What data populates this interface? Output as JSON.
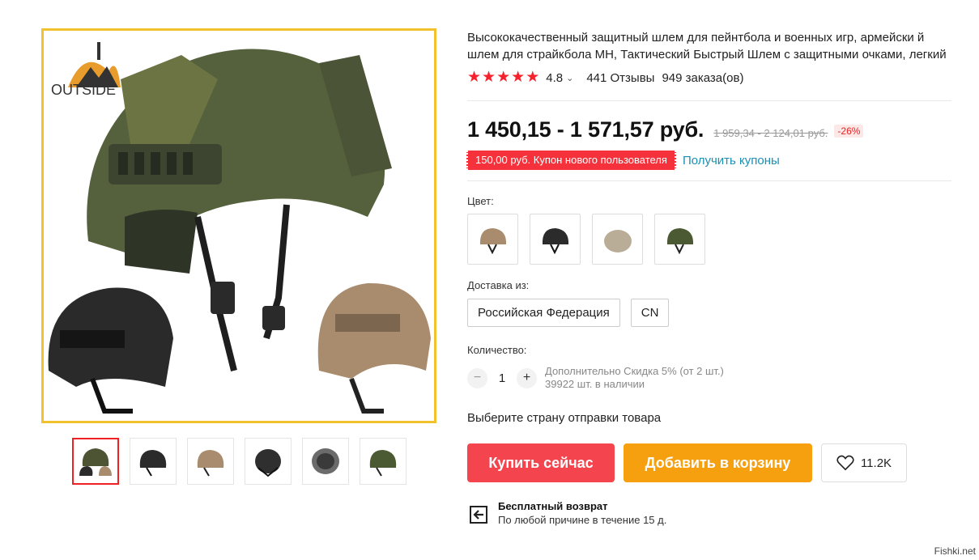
{
  "gallery": {
    "brand_logo_text": "OUTSIDE",
    "thumbnails": [
      {
        "icon": "helmet-set-thumb",
        "active": true,
        "color": "#4d5433"
      },
      {
        "icon": "helmet-black-thumb",
        "active": false,
        "color": "#2b2b2b"
      },
      {
        "icon": "helmet-tan-thumb",
        "active": false,
        "color": "#a88c6d"
      },
      {
        "icon": "helmet-black-back-thumb",
        "active": false,
        "color": "#2f2f2f"
      },
      {
        "icon": "helmet-inside-thumb",
        "active": false,
        "color": "#555"
      },
      {
        "icon": "helmet-green-thumb",
        "active": false,
        "color": "#4b5a33"
      }
    ]
  },
  "product": {
    "title": "Высококачественный защитный шлем для пейнтбола и военных игр, армейски й шлем для страйкбола MH, Тактический Быстрый Шлем с защитными очками, легкий",
    "rating": "4.8",
    "reviews": "441 Отзывы",
    "orders": "949 заказа(ов)",
    "price": "1 450,15 - 1 571,57 руб.",
    "old_price": "1 959,34 - 2 124,01 руб.",
    "discount": "-26%",
    "coupon_text": "150,00 руб. Купон нового пользователя",
    "get_coupons": "Получить купоны",
    "color_label": "Цвет:",
    "colors": [
      {
        "name": "tan",
        "color": "#a88c6d"
      },
      {
        "name": "black",
        "color": "#2b2b2b"
      },
      {
        "name": "khaki",
        "color": "#b9ad97"
      },
      {
        "name": "green",
        "color": "#4b5a33"
      }
    ],
    "ship_label": "Доставка из:",
    "ship_options": [
      "Российская Федерация",
      "CN"
    ],
    "qty_label": "Количество:",
    "qty_value": "1",
    "qty_minus": "−",
    "qty_plus": "+",
    "qty_discount": "Дополнительно Скидка 5% (от 2 шт.)",
    "stock": "39922 шт. в наличии",
    "country_note": "Выберите страну отправки товара",
    "buy_now": "Купить сейчас",
    "add_to_cart": "Добавить в корзину",
    "wishlist_count": "11.2K",
    "returns_title": "Бесплатный возврат",
    "returns_sub": "По любой причине в течение 15 д."
  },
  "watermark": "Fishki.net",
  "colors": {
    "accent_red": "#f4454e",
    "accent_orange": "#f7a00f",
    "star": "#f5222d",
    "link": "#1b8fb4"
  }
}
